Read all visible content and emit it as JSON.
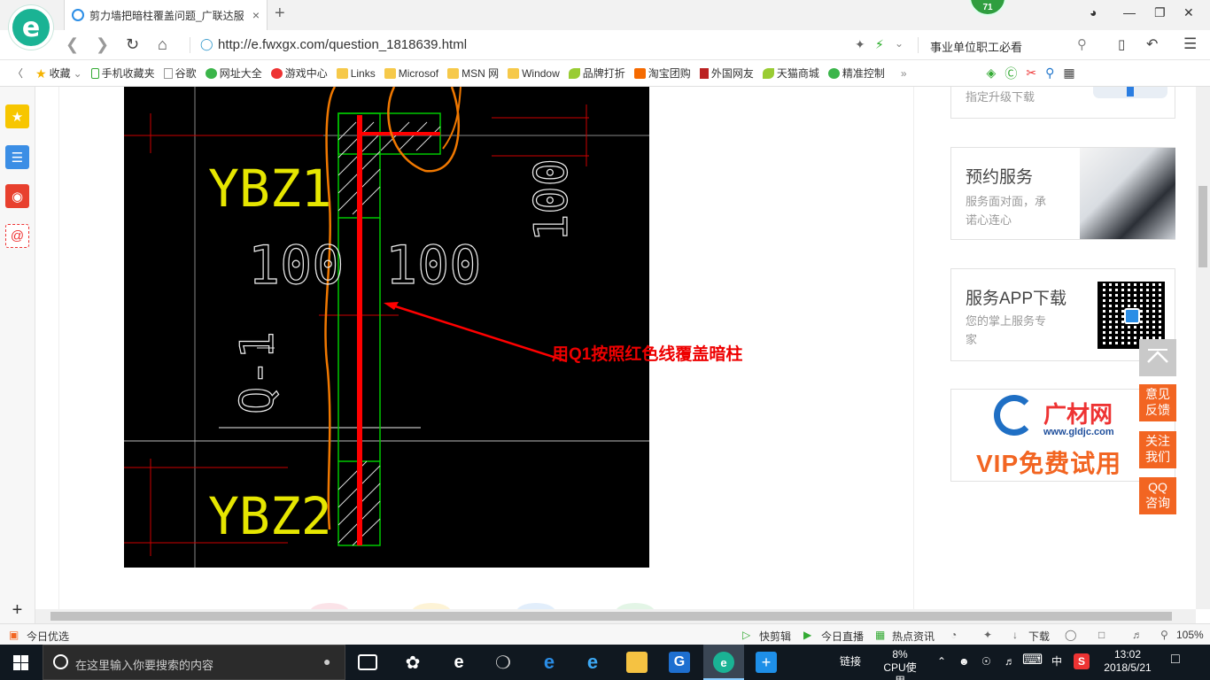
{
  "browser": {
    "tab_title": "剪力墙把暗柱覆盖问题_广联达服",
    "tab_close": "×",
    "new_tab": "+",
    "notif_count": "71",
    "url_prefix": "http://e.",
    "url_host": "fwxgx.com",
    "url_path": "/question_1818639.html",
    "search_placeholder": "事业单位职工必看"
  },
  "bookmarks": [
    {
      "label": "收藏",
      "icon": "star-icon"
    },
    {
      "label": "手机收藏夹",
      "icon": "phone-icon"
    },
    {
      "label": "谷歌",
      "icon": "page-icon"
    },
    {
      "label": "网址大全",
      "icon": "globe-icon"
    },
    {
      "label": "游戏中心",
      "icon": "game-icon"
    },
    {
      "label": "Links",
      "icon": "folder-icon"
    },
    {
      "label": "Microsof",
      "icon": "folder-icon"
    },
    {
      "label": "MSN 网",
      "icon": "folder-icon"
    },
    {
      "label": "Window",
      "icon": "folder-icon"
    },
    {
      "label": "品牌打折",
      "icon": "leaf-icon"
    },
    {
      "label": "淘宝团购",
      "icon": "taobao-icon"
    },
    {
      "label": "外国网友",
      "icon": "flag-icon"
    },
    {
      "label": "天猫商城",
      "icon": "leaf-icon"
    },
    {
      "label": "精准控制",
      "icon": "wechat-icon"
    }
  ],
  "cad": {
    "label_ybz1": "YBZ1",
    "label_ybz2": "YBZ2",
    "dim_left": "100",
    "dim_right": "100",
    "dim_vertical": "100",
    "wall_label": "Q-1",
    "annotation": "用Q1按照红色线覆盖暗柱"
  },
  "sidebar": {
    "card_upgrade_text": "指定升级下载",
    "card_booking_title": "预约服务",
    "card_booking_sub1": "服务面对面，承",
    "card_booking_sub2": "诺心连心",
    "card_app_title": "服务APP下载",
    "card_app_sub1": "您的掌上服务专",
    "card_app_sub2": "家",
    "ad_brand": "广材网",
    "ad_url": "www.gldjc.com",
    "ad_slogan": "VIP免费试用"
  },
  "float_buttons": [
    {
      "line1": "意见",
      "line2": "反馈"
    },
    {
      "line1": "关注",
      "line2": "我们"
    },
    {
      "line1": "QQ",
      "line2": "咨询"
    }
  ],
  "statusbar": {
    "today": "今日优选",
    "quick_clip": "快剪辑",
    "live": "今日直播",
    "hot_news": "热点资讯",
    "download": "下载",
    "zoom": "105%"
  },
  "taskbar": {
    "search_placeholder": "在这里输入你要搜索的内容",
    "links": "链接",
    "cpu_value": "8%",
    "cpu_label": "CPU使用",
    "ime": "中",
    "time": "13:02",
    "date": "2018/5/21"
  },
  "colors": {
    "browser_green": "#1ab394",
    "float_orange": "#f26522",
    "cad_red": "#ff0000",
    "cad_yellow": "#e6e600",
    "cad_green": "#00c800"
  }
}
